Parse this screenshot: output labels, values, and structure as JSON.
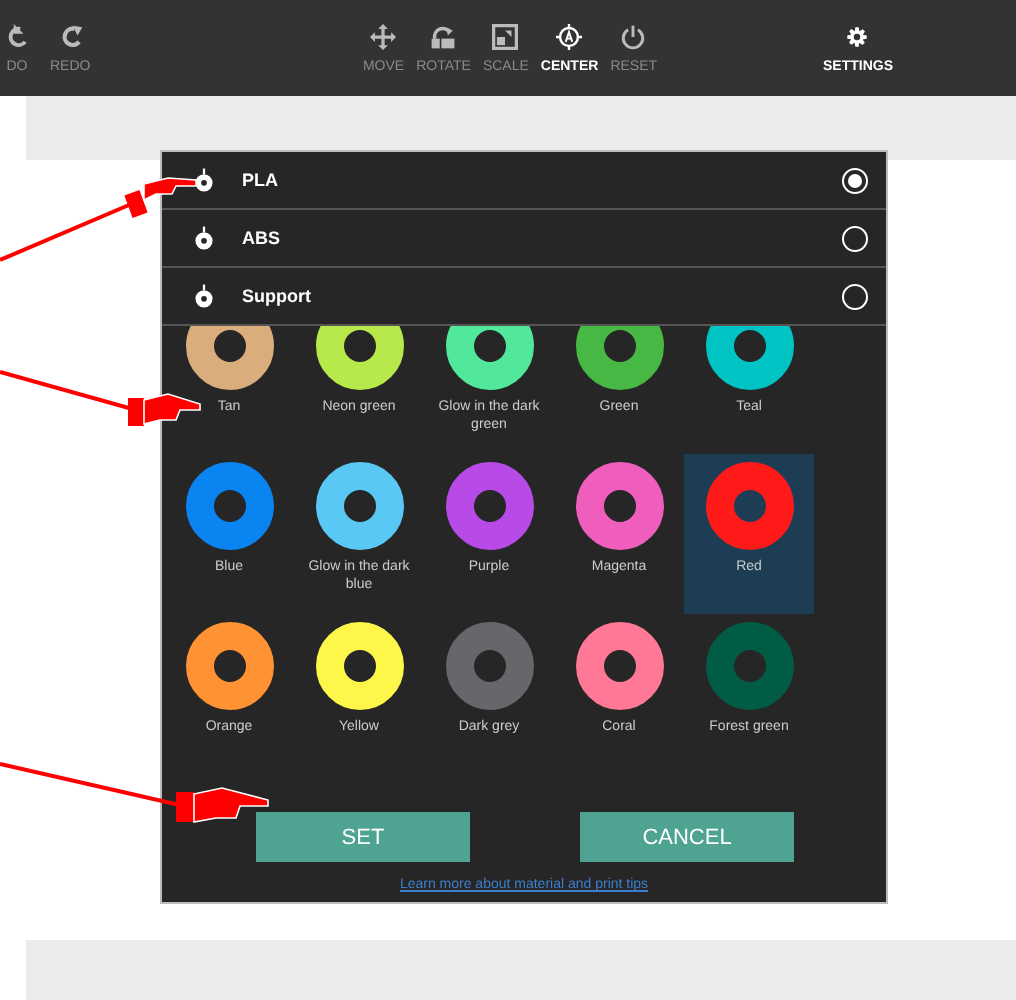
{
  "toolbar": {
    "left": [
      {
        "label": "DO",
        "kind": "undo",
        "disabled": true
      },
      {
        "label": "REDO",
        "kind": "redo",
        "disabled": true
      }
    ],
    "center": [
      {
        "label": "MOVE",
        "kind": "move",
        "disabled": true
      },
      {
        "label": "ROTATE",
        "kind": "rotate",
        "disabled": true
      },
      {
        "label": "SCALE",
        "kind": "scale",
        "disabled": true
      },
      {
        "label": "CENTER",
        "kind": "center",
        "disabled": false
      },
      {
        "label": "RESET",
        "kind": "reset",
        "disabled": true
      }
    ],
    "right": [
      {
        "label": "SETTINGS",
        "kind": "settings",
        "disabled": false
      }
    ]
  },
  "dialog": {
    "materials": [
      {
        "label": "PLA",
        "selected": true
      },
      {
        "label": "ABS",
        "selected": false
      },
      {
        "label": "Support",
        "selected": false
      }
    ],
    "colors": [
      {
        "name": "Tan",
        "color": "#d9ad7c",
        "selected": false
      },
      {
        "name": "Neon green",
        "color": "#b8e94a",
        "selected": false
      },
      {
        "name": "Glow in the dark green",
        "color": "#52e89c",
        "selected": false
      },
      {
        "name": "Green",
        "color": "#47b843",
        "selected": false
      },
      {
        "name": "Teal",
        "color": "#00c4c4",
        "selected": false
      },
      {
        "name": "Blue",
        "color": "#0a84f0",
        "selected": false
      },
      {
        "name": "Glow in the dark blue",
        "color": "#5ac8f5",
        "selected": false
      },
      {
        "name": "Purple",
        "color": "#b84ae8",
        "selected": false
      },
      {
        "name": "Magenta",
        "color": "#f05ebd",
        "selected": false
      },
      {
        "name": "Red",
        "color": "#ff1a1a",
        "selected": true
      },
      {
        "name": "Orange",
        "color": "#ff9233",
        "selected": false
      },
      {
        "name": "Yellow",
        "color": "#fff64a",
        "selected": false
      },
      {
        "name": "Dark grey",
        "color": "#66676b",
        "selected": false
      },
      {
        "name": "Coral",
        "color": "#ff7896",
        "selected": false
      },
      {
        "name": "Forest green",
        "color": "#005c45",
        "selected": false
      }
    ],
    "buttons": [
      {
        "label": "SET"
      },
      {
        "label": "CANCEL"
      }
    ],
    "link": "Learn more about material and print tips"
  }
}
